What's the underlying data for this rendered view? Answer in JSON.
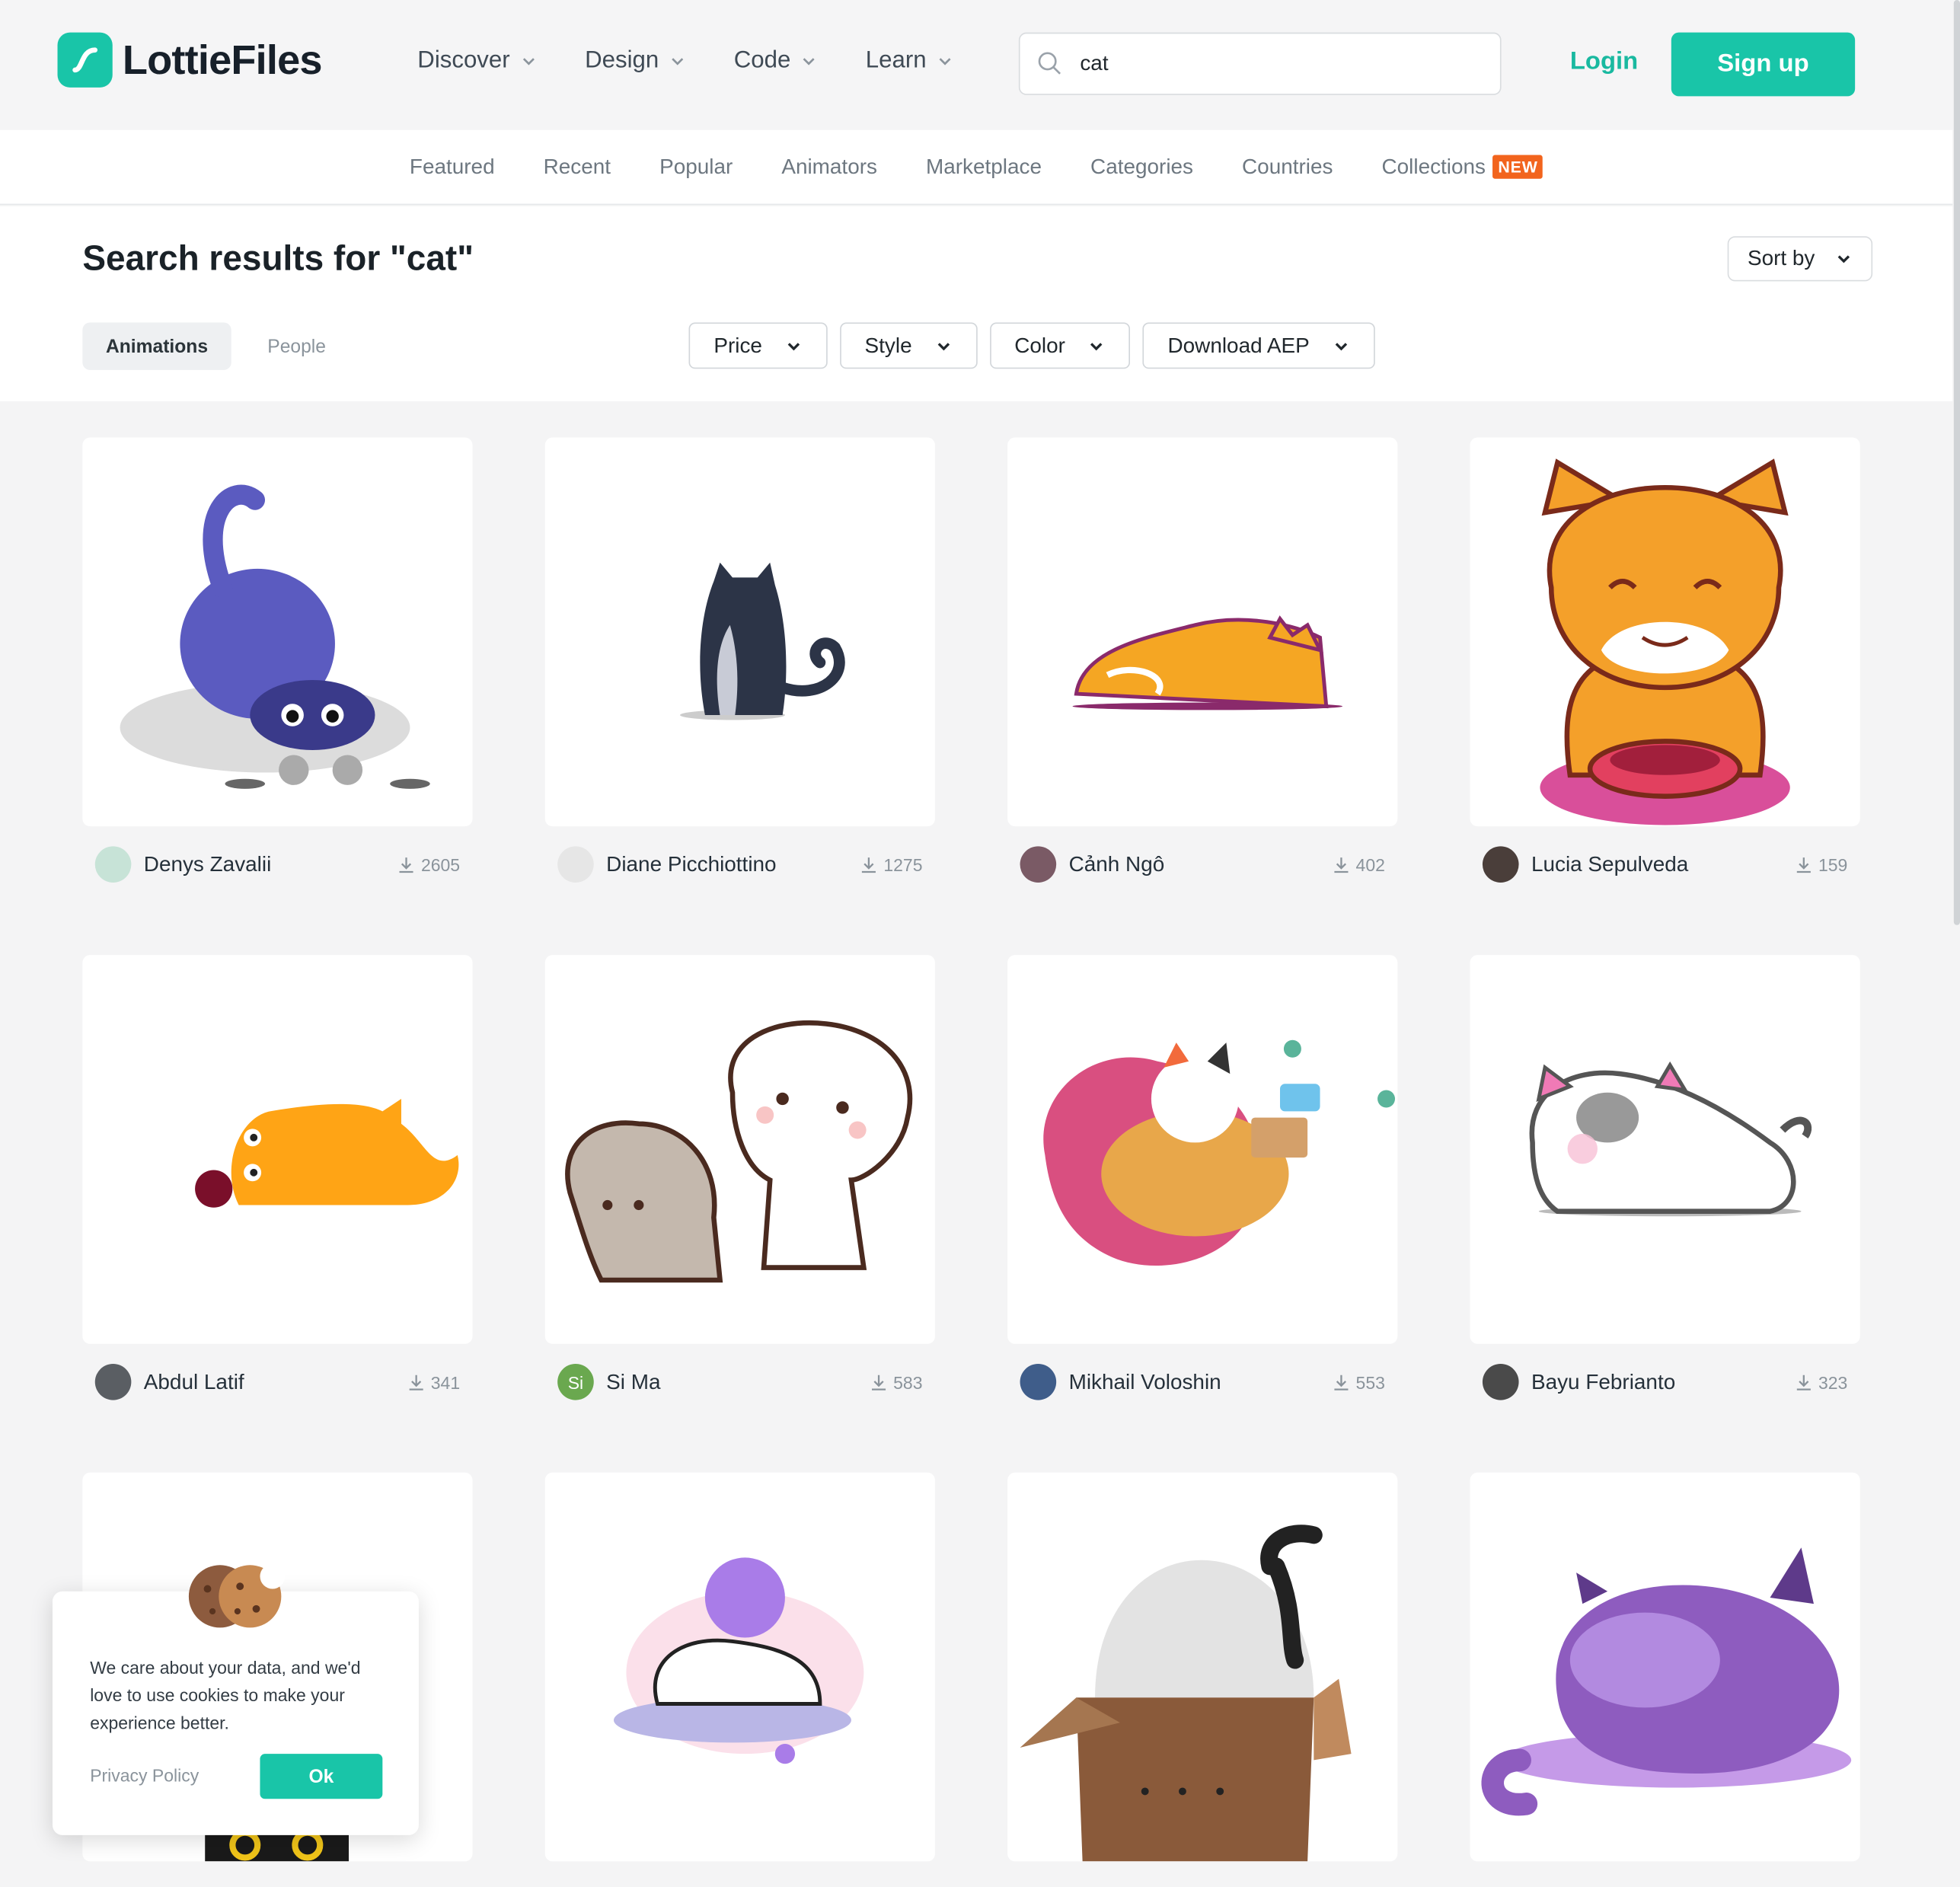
{
  "brand": {
    "name": "LottieFiles",
    "accent": "#19c5a8",
    "badge_color": "#f2641d"
  },
  "nav": [
    {
      "label": "Discover"
    },
    {
      "label": "Design"
    },
    {
      "label": "Code"
    },
    {
      "label": "Learn"
    }
  ],
  "search": {
    "value": "cat",
    "icon": "search-icon"
  },
  "auth": {
    "login": "Login",
    "signup": "Sign up"
  },
  "subnav": [
    {
      "label": "Featured"
    },
    {
      "label": "Recent"
    },
    {
      "label": "Popular"
    },
    {
      "label": "Animators"
    },
    {
      "label": "Marketplace"
    },
    {
      "label": "Categories"
    },
    {
      "label": "Countries"
    },
    {
      "label": "Collections",
      "badge": "NEW"
    }
  ],
  "results": {
    "title": "Search results for \"cat\"",
    "sort_label": "Sort by",
    "tabs": {
      "animations": "Animations",
      "people": "People"
    }
  },
  "filters": [
    {
      "label": "Price"
    },
    {
      "label": "Style"
    },
    {
      "label": "Color"
    },
    {
      "label": "Download AEP"
    }
  ],
  "cards": [
    {
      "author": "Denys Zavalii",
      "downloads": "2605"
    },
    {
      "author": "Diane Picchiottino",
      "downloads": "1275"
    },
    {
      "author": "Cảnh Ngô",
      "downloads": "402"
    },
    {
      "author": "Lucia Sepulveda",
      "downloads": "159"
    },
    {
      "author": "Abdul Latif",
      "downloads": "341"
    },
    {
      "author": "Si Ma",
      "downloads": "583",
      "initials": "Si"
    },
    {
      "author": "Mikhail Voloshin",
      "downloads": "553"
    },
    {
      "author": "Bayu Febrianto",
      "downloads": "323"
    }
  ],
  "cookie": {
    "text": "We care about your data, and we'd love to use cookies to make your experience better.",
    "privacy": "Privacy Policy",
    "ok": "Ok"
  }
}
